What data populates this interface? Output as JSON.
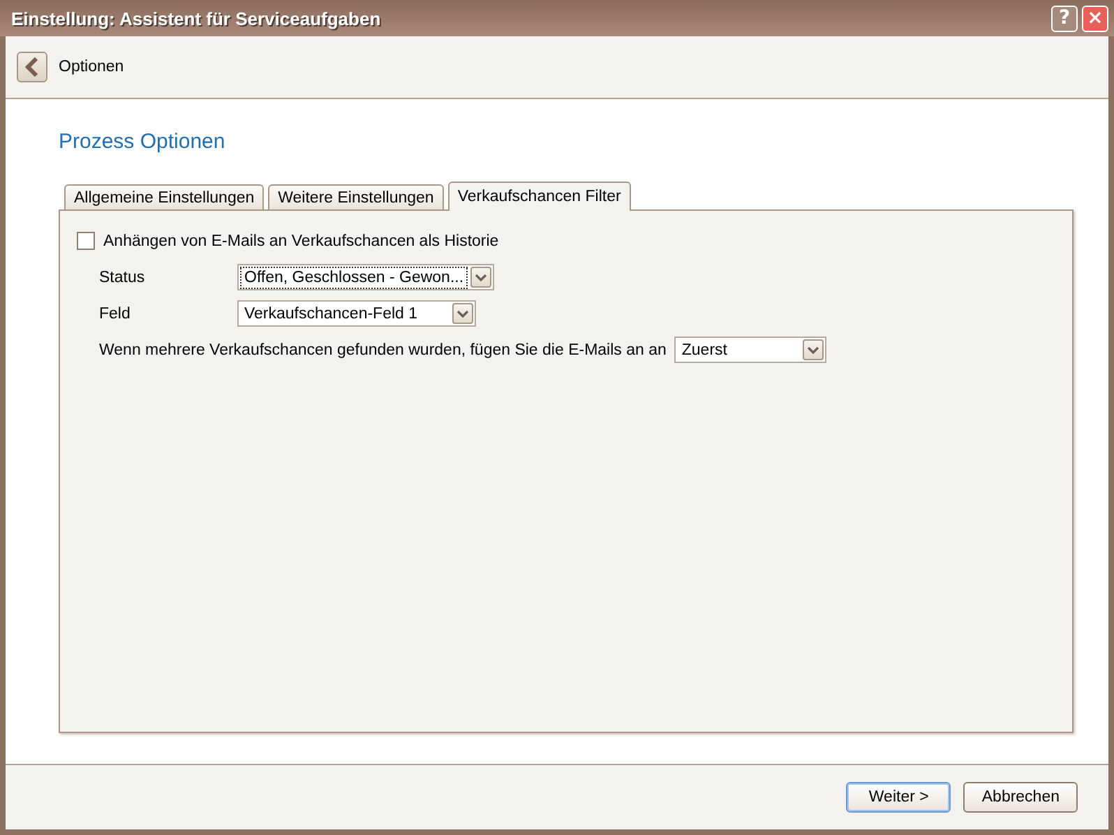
{
  "window": {
    "title": "Einstellung: Assistent für Serviceaufgaben",
    "help_button": "?",
    "close_button": "×"
  },
  "header": {
    "back_label": "Optionen"
  },
  "section_title": "Prozess Optionen",
  "tabs": [
    {
      "label": "Allgemeine Einstellungen",
      "selected": false
    },
    {
      "label": "Weitere Einstellungen",
      "selected": false
    },
    {
      "label": "Verkaufschancen Filter",
      "selected": true
    }
  ],
  "options": [
    {
      "kind": "checkbox",
      "label": "Anhängen von E-Mails an Verkaufschancen als Historie",
      "checked": false
    },
    {
      "kind": "combo",
      "label": "Status",
      "value": "Offen, Geschlossen - Gewon...",
      "focused": true
    },
    {
      "kind": "combo",
      "label": "Feld",
      "value": "Verkaufschancen-Feld 1",
      "focused": false
    },
    {
      "kind": "inline-combo",
      "label": "Wenn mehrere Verkaufschancen gefunden wurden, fügen Sie die E-Mails an an",
      "value": "Zuerst",
      "focused": false
    }
  ],
  "buttons": [
    {
      "label": "Weiter >",
      "default": true
    },
    {
      "label": "Abbrechen",
      "default": false
    }
  ]
}
